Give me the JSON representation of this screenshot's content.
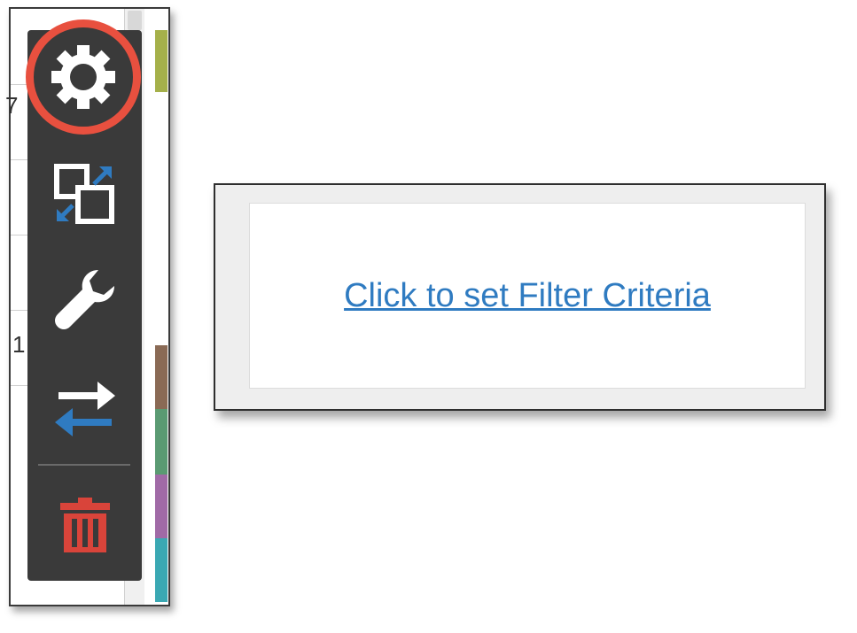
{
  "filter_panel": {
    "link_text": "Click to set Filter Criteria"
  },
  "background_fragments": {
    "top_char": "7",
    "mid_char": "1"
  },
  "toolbar": {
    "items": [
      {
        "name": "settings",
        "icon": "gear-icon",
        "highlighted": true
      },
      {
        "name": "resize",
        "icon": "resize-icon"
      },
      {
        "name": "configure",
        "icon": "wrench-icon"
      },
      {
        "name": "swap",
        "icon": "swap-arrows-icon"
      },
      {
        "name": "delete",
        "icon": "trash-icon"
      }
    ]
  },
  "colors": {
    "toolbar_bg": "#3a3a3a",
    "highlight_ring": "#e8503f",
    "link": "#2f7bc1",
    "accent_blue": "#2f7bc1",
    "delete_red": "#d9443a",
    "strip_colors": [
      "#a5b04a",
      "#8a6a55",
      "#5a9a72",
      "#a06aa6",
      "#3aa8b3"
    ]
  }
}
